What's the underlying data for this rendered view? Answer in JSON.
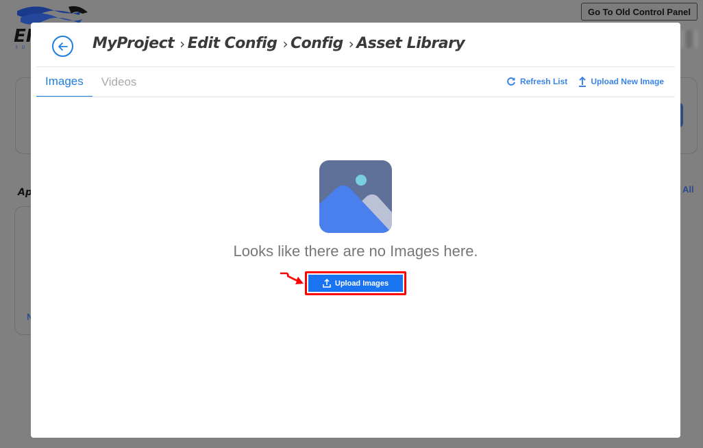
{
  "background": {
    "logo_text": "EI",
    "logo_sub": "3D",
    "old_panel_button": "Go To Old Control Panel",
    "section_title_partial": "Ap",
    "view_all_partial": "All",
    "link_partial": "N"
  },
  "modal": {
    "breadcrumb": [
      "MyProject",
      "Edit Config",
      "Config",
      "Asset Library"
    ],
    "separator": "›",
    "tabs": [
      {
        "label": "Images",
        "active": true
      },
      {
        "label": "Videos",
        "active": false
      }
    ],
    "actions": {
      "refresh": "Refresh List",
      "upload_new": "Upload New Image"
    },
    "empty_state": {
      "message": "Looks like there are no Images here.",
      "button": "Upload Images"
    }
  },
  "colors": {
    "accent": "#1e7ee0",
    "button": "#1a73f0",
    "highlight": "#ff0000",
    "overlay": "#808080"
  }
}
